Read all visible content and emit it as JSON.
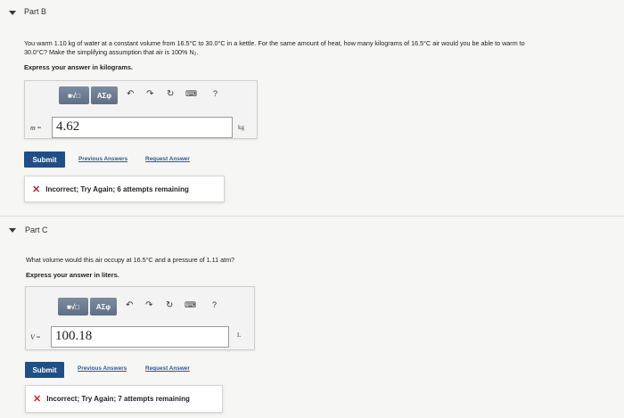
{
  "part_b": {
    "title": "Part B",
    "question_line1": "You warm 1.10 kg of water at a constant volume from 16.5°C to 30.0°C in a kettle. For the same amount of heat, how many kilograms of 16.5°C air would you be able to warm to",
    "question_line2": "30.0°C? Make the simplifying assumption that air is 100% N₂.",
    "express": "Express your answer in kilograms.",
    "toolbar": {
      "templates": "■√□",
      "greek": "ΑΣφ",
      "help": "?"
    },
    "variable": "m",
    "equals": "=",
    "answer_value": "4.62",
    "unit": "kg",
    "submit": "Submit",
    "previous_answers": "Previous Answers",
    "request_answer": "Request Answer",
    "feedback_icon": "✕",
    "feedback": "Incorrect; Try Again; 6 attempts remaining"
  },
  "part_c": {
    "title": "Part C",
    "question": "What volume would this air occupy at 16.5°C and a pressure of 1.11 atm?",
    "express": "Express your answer in liters.",
    "toolbar": {
      "templates": "■√□",
      "greek": "ΑΣφ",
      "help": "?"
    },
    "variable": "V",
    "equals": "=",
    "answer_value": "100.18",
    "unit": "L",
    "submit": "Submit",
    "previous_answers": "Previous Answers",
    "request_answer": "Request Answer",
    "feedback_icon": "✕",
    "feedback": "Incorrect; Try Again; 7 attempts remaining"
  }
}
